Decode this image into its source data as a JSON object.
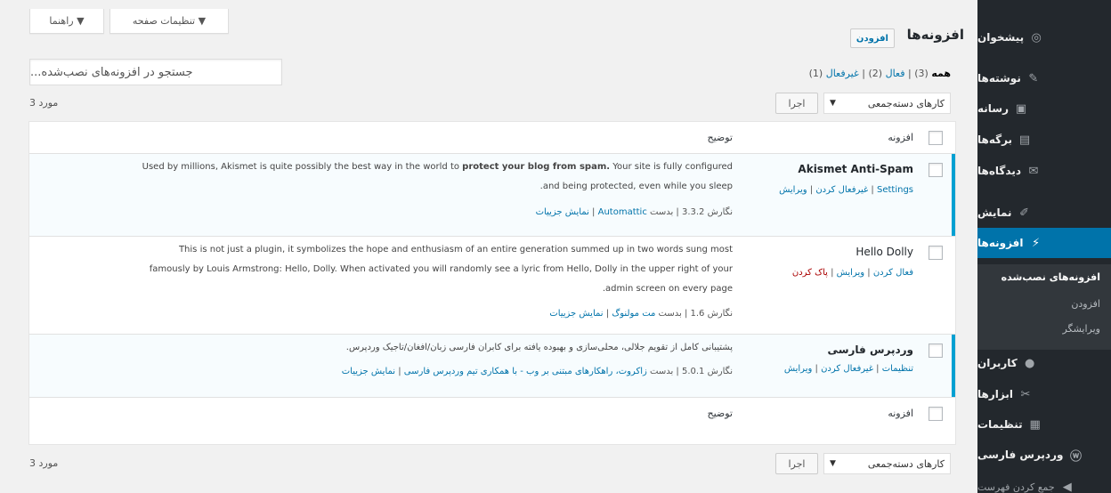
{
  "sidebar": {
    "items": [
      {
        "label": "پیشخوان",
        "icon": "dashboard-icon",
        "glyph": "◎"
      },
      {
        "label": "نوشته‌ها",
        "icon": "pin-icon",
        "glyph": "✎"
      },
      {
        "label": "رسانه",
        "icon": "media-icon",
        "glyph": "▣"
      },
      {
        "label": "برگه‌ها",
        "icon": "page-icon",
        "glyph": "▤"
      },
      {
        "label": "دیدگاه‌ها",
        "icon": "comments-icon",
        "glyph": "✉"
      },
      {
        "label": "نمایش",
        "icon": "appearance-icon",
        "glyph": "✐"
      },
      {
        "label": "افزونه‌ها",
        "icon": "plugins-icon",
        "glyph": "⚡"
      },
      {
        "label": "کاربران",
        "icon": "users-icon",
        "glyph": "●"
      },
      {
        "label": "ابزارها",
        "icon": "tools-icon",
        "glyph": "✂"
      },
      {
        "label": "تنظیمات",
        "icon": "settings-icon",
        "glyph": "▦"
      },
      {
        "label": "وردپرس فارسی",
        "icon": "wp-farsi-icon",
        "glyph": "ⓦ"
      },
      {
        "label": "جمع کردن فهرست",
        "icon": "collapse-icon",
        "glyph": "◀"
      }
    ],
    "submenu": [
      "افزونه‌های نصب‌شده",
      "افزودن",
      "ویرایشگر"
    ]
  },
  "screen_meta": {
    "options_label": "تنظیمات صفحه ▼",
    "help_label": "راهنما ▼"
  },
  "header": {
    "title": "افزونه‌ها",
    "add_new": "افزودن"
  },
  "filters": {
    "all": "همه",
    "all_count": "(3)",
    "sep1": "|",
    "active": "فعال",
    "active_count": "(2)",
    "sep2": "|",
    "inactive": "غیرفعال",
    "inactive_count": "(1)"
  },
  "search": {
    "placeholder": "جستجو در افزونه‌های نصب‌شده..."
  },
  "bulk": {
    "label": "کارهای دسته‌جمعی",
    "caret": "▼",
    "apply": "اجرا"
  },
  "count": "3 مورد",
  "table": {
    "col_plugin": "افزونه",
    "col_description": "توضیح"
  },
  "plugins": [
    {
      "name": "Akismet Anti-Spam",
      "active": true,
      "actions": [
        "Settings",
        "غیرفعال کردن",
        "ویرایش"
      ],
      "desc_line1_a": "Used by millions, Akismet is quite possibly the best way in the world to ",
      "desc_line1_b": "protect your blog from spam.",
      "desc_line1_c": " Your site is fully configured",
      "desc_line2": ".and being protected, even while you sleep",
      "version_label": "نگارش 3.3.2 | بدست ",
      "author": "Automattic",
      "details_sep": " | ",
      "details": "نمایش جزییات"
    },
    {
      "name": "Hello Dolly",
      "active": false,
      "actions": [
        "فعال کردن",
        "ویرایش",
        "پاک کردن"
      ],
      "desc_line1": "This is not just a plugin, it symbolizes the hope and enthusiasm of an entire generation summed up in two words sung most",
      "desc_line2": "famously by Louis Armstrong: Hello, Dolly. When activated you will randomly see a lyric from Hello, Dolly in the upper right of your",
      "desc_line3": ".admin screen on every page",
      "version_label": "نگارش 1.6 | بدست ",
      "author": "مت مولنوگ",
      "details_sep": " | ",
      "details": "نمایش جزییات"
    },
    {
      "name": "وردپرس فارسی",
      "active": true,
      "actions": [
        "تنظیمات",
        "غیرفعال کردن",
        "ویرایش"
      ],
      "desc_line1": "پشتیبانی کامل از تقویم جلالی، محلی‌سازی و بهبوده یافته برای کابران فارسی زبان/افغان/تاجیک وردپرس.",
      "version_label": "نگارش 5.0.1 | بدست ",
      "author": "زاکروت، راهکارهای مبتنی بر وب - با همکاری تیم وردپرس فارسی",
      "details_sep": " | ",
      "details": "نمایش جزییات"
    }
  ],
  "colors": {
    "sidebar_bg": "#23282d",
    "accent": "#0073aa",
    "active_row_bg": "#f7fcfe",
    "active_border": "#00a0d2",
    "delete": "#a00"
  }
}
